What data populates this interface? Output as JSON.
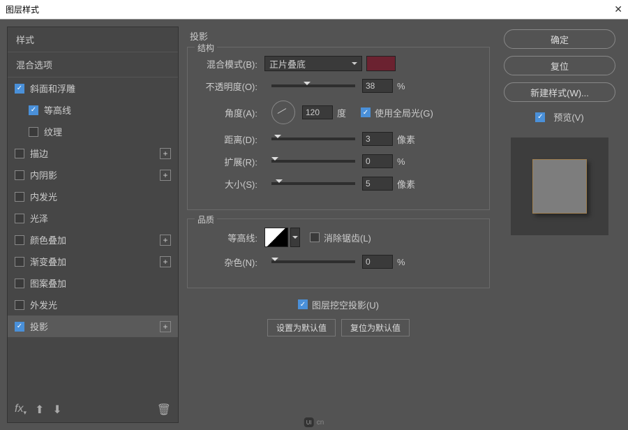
{
  "titlebar": {
    "title": "图层样式"
  },
  "left": {
    "header1": "样式",
    "header2": "混合选项",
    "items": [
      {
        "label": "斜面和浮雕",
        "checked": true,
        "plus": false,
        "indent": false
      },
      {
        "label": "等高线",
        "checked": true,
        "plus": false,
        "indent": true
      },
      {
        "label": "纹理",
        "checked": false,
        "plus": false,
        "indent": true
      },
      {
        "label": "描边",
        "checked": false,
        "plus": true,
        "indent": false
      },
      {
        "label": "内阴影",
        "checked": false,
        "plus": true,
        "indent": false
      },
      {
        "label": "内发光",
        "checked": false,
        "plus": false,
        "indent": false
      },
      {
        "label": "光泽",
        "checked": false,
        "plus": false,
        "indent": false
      },
      {
        "label": "颜色叠加",
        "checked": false,
        "plus": true,
        "indent": false
      },
      {
        "label": "渐变叠加",
        "checked": false,
        "plus": true,
        "indent": false
      },
      {
        "label": "图案叠加",
        "checked": false,
        "plus": false,
        "indent": false
      },
      {
        "label": "外发光",
        "checked": false,
        "plus": false,
        "indent": false
      },
      {
        "label": "投影",
        "checked": true,
        "plus": true,
        "indent": false,
        "selected": true
      }
    ],
    "footer_fx": "fx"
  },
  "mid": {
    "title": "投影",
    "structure": {
      "legend": "结构",
      "blend_label": "混合模式(B):",
      "blend_value": "正片叠底",
      "opacity_label": "不透明度(O):",
      "opacity_value": "38",
      "opacity_unit": "%",
      "angle_label": "角度(A):",
      "angle_value": "120",
      "angle_unit": "度",
      "global_light": "使用全局光(G)",
      "distance_label": "距离(D):",
      "distance_value": "3",
      "distance_unit": "像素",
      "spread_label": "扩展(R):",
      "spread_value": "0",
      "spread_unit": "%",
      "size_label": "大小(S):",
      "size_value": "5",
      "size_unit": "像素"
    },
    "quality": {
      "legend": "品质",
      "contour_label": "等高线:",
      "antialias": "消除锯齿(L)",
      "noise_label": "杂色(N):",
      "noise_value": "0",
      "noise_unit": "%"
    },
    "knockout": "图层挖空投影(U)",
    "btn_default": "设置为默认值",
    "btn_reset": "复位为默认值"
  },
  "right": {
    "ok": "确定",
    "cancel": "复位",
    "new_style": "新建样式(W)...",
    "preview": "预览(V)"
  },
  "footer": {
    "logo": "UI",
    "text": "cn"
  }
}
